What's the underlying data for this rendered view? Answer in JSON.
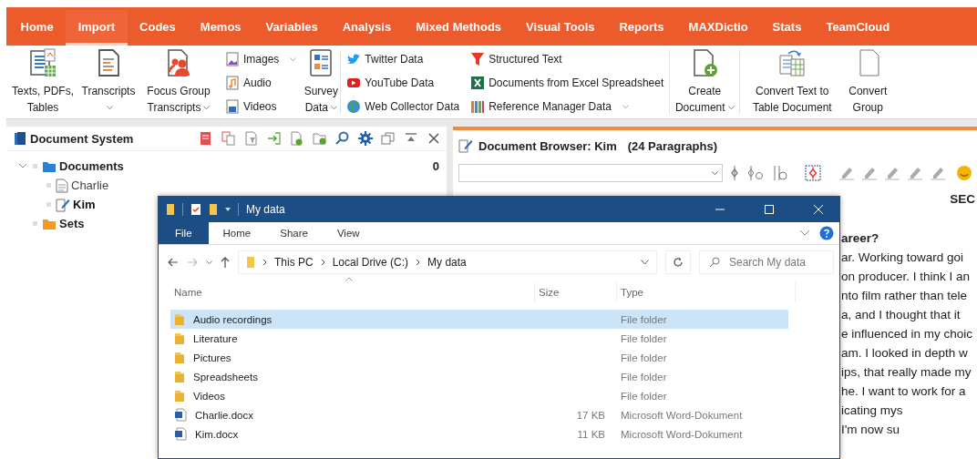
{
  "app_tabs": [
    {
      "label": "Home",
      "selected": false
    },
    {
      "label": "Import",
      "selected": true
    },
    {
      "label": "Codes",
      "selected": false
    },
    {
      "label": "Memos",
      "selected": false
    },
    {
      "label": "Variables",
      "selected": false
    },
    {
      "label": "Analysis",
      "selected": false
    },
    {
      "label": "Mixed Methods",
      "selected": false
    },
    {
      "label": "Visual Tools",
      "selected": false
    },
    {
      "label": "Reports",
      "selected": false
    },
    {
      "label": "MAXDictio",
      "selected": false
    },
    {
      "label": "Stats",
      "selected": false
    },
    {
      "label": "TeamCloud",
      "selected": false
    }
  ],
  "ribbon": [
    {
      "kind": "large",
      "label": "Texts, PDFs, Tables",
      "dropdown": false
    },
    {
      "kind": "large",
      "label": "Transcripts",
      "dropdown": true
    },
    {
      "kind": "large",
      "label": "Focus Group Transcripts",
      "dropdown": true
    },
    {
      "kind": "stack",
      "items": [
        {
          "label": "Images",
          "dropdown": true
        },
        {
          "label": "Audio",
          "dropdown": false
        },
        {
          "label": "Videos",
          "dropdown": false
        }
      ]
    },
    {
      "kind": "large",
      "label": "Survey Data",
      "dropdown": true
    },
    {
      "kind": "stack",
      "items": [
        {
          "label": "Twitter Data",
          "dropdown": false
        },
        {
          "label": "YouTube Data",
          "dropdown": false
        },
        {
          "label": "Web Collector Data",
          "dropdown": false
        }
      ]
    },
    {
      "kind": "stack",
      "items": [
        {
          "label": "Structured Text",
          "dropdown": false
        },
        {
          "label": "Documents from Excel Spreadsheet",
          "dropdown": false
        },
        {
          "label": "Reference Manager Data",
          "dropdown": true
        }
      ]
    },
    {
      "kind": "large",
      "label": "Create Document",
      "dropdown": true
    },
    {
      "kind": "large",
      "label": "Convert Text to Table Document",
      "dropdown": false
    },
    {
      "kind": "large",
      "label": "Convert Group",
      "dropdown": false
    }
  ],
  "document_system": {
    "title": "Document System",
    "tree": [
      {
        "label": "Documents",
        "expanded": true,
        "count": "0",
        "children": [
          {
            "label": "Charlie",
            "active": false
          },
          {
            "label": "Kim",
            "active": true
          }
        ]
      },
      {
        "label": "Sets"
      }
    ]
  },
  "document_browser": {
    "title": "Document Browser: Kim",
    "paragraphs": "(24 Paragraphs)",
    "heading": "SEC",
    "lines": [
      {
        "text": "areer?",
        "bold": true
      },
      {
        "text": "ar. Working toward goi",
        "bold": false
      },
      {
        "text": "on producer. I think I an",
        "bold": false
      },
      {
        "text": "nto film rather than tele",
        "bold": false
      },
      {
        "text": "a, and I thought that it",
        "bold": false
      },
      {
        "text": "e influenced in my choic",
        "bold": false
      },
      {
        "text": "am. I looked in depth w",
        "bold": false
      },
      {
        "text": "ips, that really made my",
        "bold": false
      },
      {
        "text": "he. I want to work for a",
        "bold": false
      },
      {
        "text": "icating mys",
        "bold": false
      },
      {
        "text": "I'm now su",
        "bold": false
      }
    ]
  },
  "explorer": {
    "title": "My data",
    "tabs": [
      {
        "label": "File",
        "selected": true
      },
      {
        "label": "Home",
        "selected": false
      },
      {
        "label": "Share",
        "selected": false
      },
      {
        "label": "View",
        "selected": false
      }
    ],
    "breadcrumb": [
      "This PC",
      "Local Drive (C:)",
      "My data"
    ],
    "search": {
      "placeholder": "Search My data"
    },
    "columns": [
      "Name",
      "Size",
      "Type"
    ],
    "rows": [
      {
        "kind": "folder",
        "name": "Audio recordings",
        "type": "File folder",
        "selected": true
      },
      {
        "kind": "folder",
        "name": "Literature",
        "type": "File folder",
        "selected": false
      },
      {
        "kind": "folder",
        "name": "Pictures",
        "type": "File folder",
        "selected": false
      },
      {
        "kind": "folder",
        "name": "Spreadsheets",
        "type": "File folder",
        "selected": false
      },
      {
        "kind": "folder",
        "name": "Videos",
        "type": "File folder",
        "selected": false
      },
      {
        "kind": "document",
        "name": "Charlie.docx",
        "size": "17 KB",
        "type": "Microsoft Word-Dokument",
        "selected": false
      },
      {
        "kind": "document",
        "name": "Kim.docx",
        "size": "11 KB",
        "type": "Microsoft Word-Dokument",
        "selected": false
      }
    ]
  }
}
